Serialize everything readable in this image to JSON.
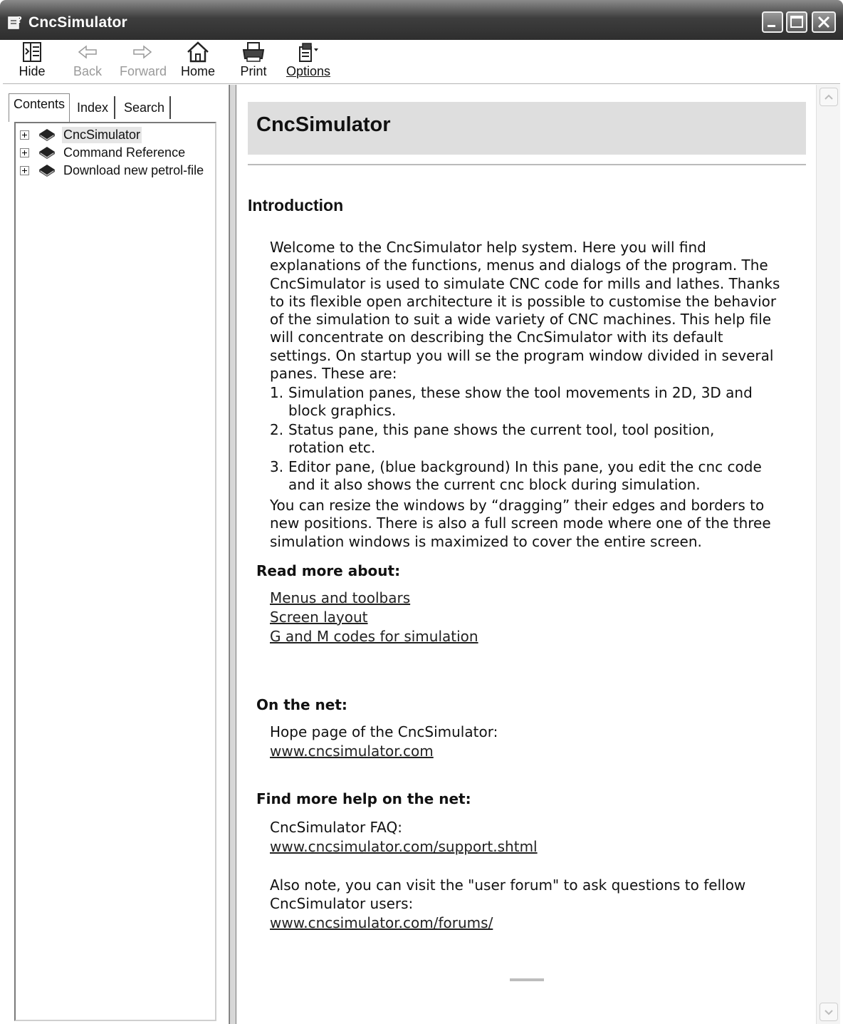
{
  "window": {
    "title": "CncSimulator"
  },
  "toolbar": {
    "hide": "Hide",
    "back": "Back",
    "forward": "Forward",
    "home": "Home",
    "print": "Print",
    "options": "Options"
  },
  "tabs": {
    "contents": "Contents",
    "index": "Index",
    "search": "Search"
  },
  "tree": {
    "items": [
      {
        "label": "CncSimulator",
        "icon": "book-icon"
      },
      {
        "label": "Command Reference",
        "icon": "book-icon"
      },
      {
        "label": "Download new petrol-file",
        "icon": "book-icon"
      }
    ]
  },
  "content": {
    "title": "CncSimulator",
    "intro_heading": "Introduction",
    "intro_lines": [
      "Welcome to the CncSimulator help system. Here you will find",
      "explanations of the functions, menus and dialogs of the program. The",
      "CncSimulator is used to simulate CNC code for mills and lathes. Thanks",
      "to its flexible open architecture it is possible to customise the behavior",
      "of the simulation to suit a wide variety of CNC machines. This help file",
      "will concentrate on describing the CncSimulator with its default",
      "settings. On startup you will se the program window divided in several",
      "panes. These are:"
    ],
    "list": [
      {
        "num": "1.",
        "lines": [
          "Simulation panes, these show the tool movements in 2D, 3D and",
          "block graphics."
        ]
      },
      {
        "num": "2.",
        "lines": [
          "Status pane, this pane shows the current tool, tool position,",
          "rotation etc."
        ]
      },
      {
        "num": "3.",
        "lines": [
          "Editor pane, (blue background) In this pane, you edit the cnc code",
          "and it also shows the current cnc block during simulation."
        ]
      }
    ],
    "after_lines": [
      "You can resize the windows by “dragging” their edges and borders to",
      "new positions. There is also a full screen mode where one of the three",
      "simulation windows is maximized to cover the entire screen."
    ],
    "read_more_heading": "Read more about:",
    "read_more_links": [
      "Menus and toolbars",
      "Screen layout",
      "G and M codes for simulation"
    ],
    "net_heading": "On the net:",
    "net_text": "Hope page of the CncSimulator:",
    "net_link": "www.cncsimulator.com",
    "help_heading": "Find more help on the net:",
    "faq_text": "CncSimulator FAQ:",
    "faq_link": "www.cncsimulator.com/support.shtml",
    "forum_lines": [
      "Also note, you can visit the \"user forum\" to ask questions to fellow",
      "CncSimulator users:"
    ],
    "forum_link": "www.cncsimulator.com/forums/"
  }
}
